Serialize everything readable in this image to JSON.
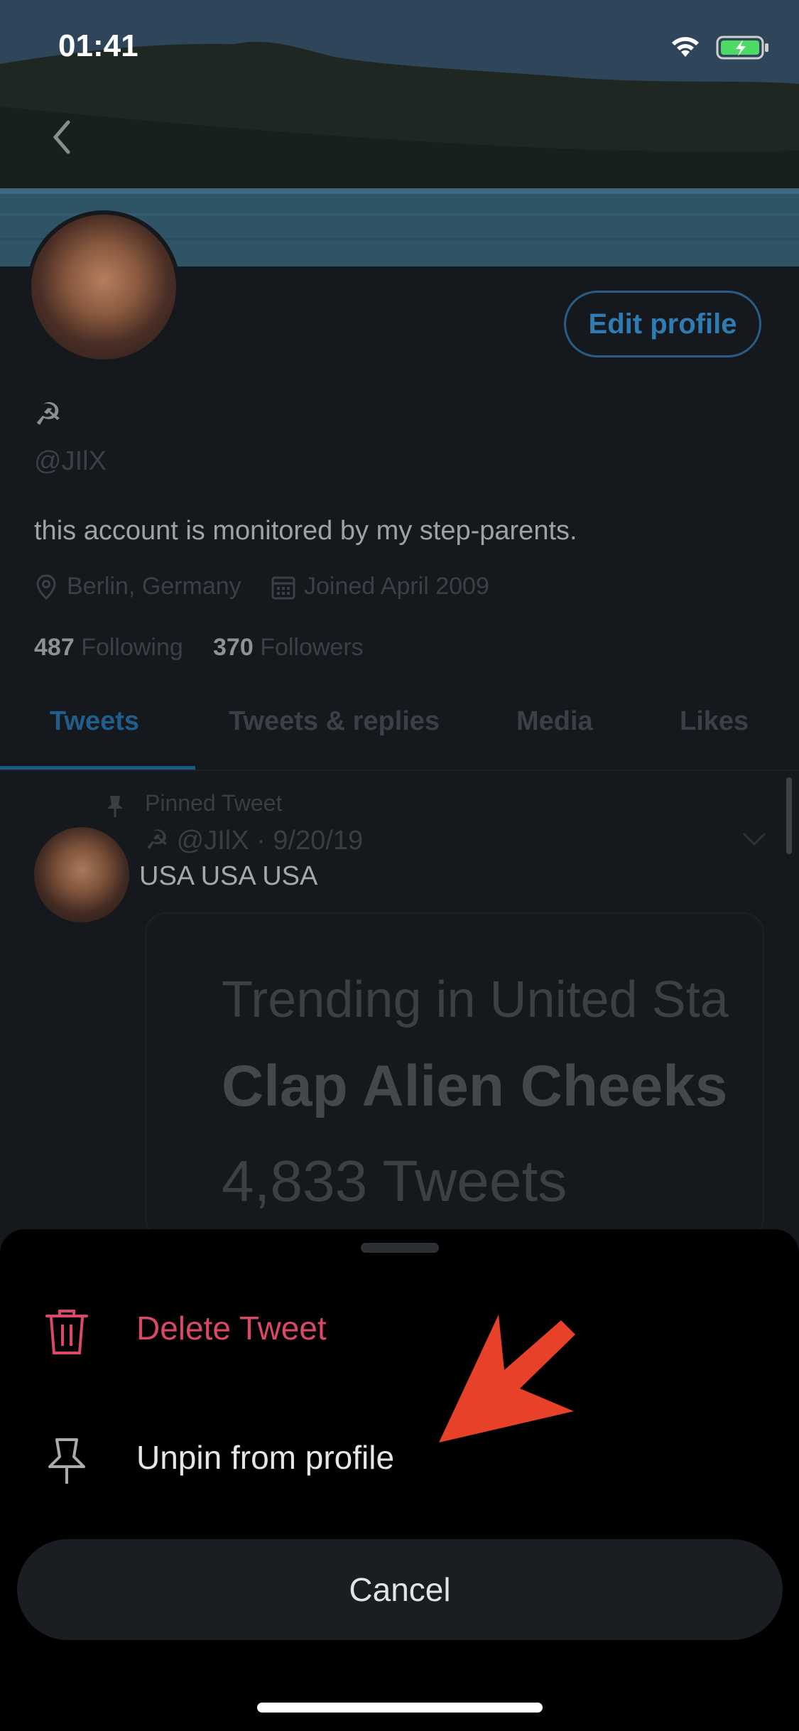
{
  "status_bar": {
    "time": "01:41"
  },
  "profile": {
    "edit_button": "Edit profile",
    "name": "☭",
    "handle": "@JIlX",
    "bio": "this account is monitored by my step-parents.",
    "location": "Berlin, Germany",
    "joined": "Joined April 2009",
    "following_count": "487",
    "following_label": "Following",
    "followers_count": "370",
    "followers_label": "Followers"
  },
  "tabs": [
    {
      "label": "Tweets",
      "active": true
    },
    {
      "label": "Tweets & replies",
      "active": false
    },
    {
      "label": "Media",
      "active": false
    },
    {
      "label": "Likes",
      "active": false
    }
  ],
  "pinned_tweet": {
    "pinned_label": "Pinned Tweet",
    "meta": "☭ @JIlX · 9/20/19",
    "text": "USA USA USA",
    "card": {
      "line1": "Trending in United Sta",
      "line2": "Clap Alien Cheeks",
      "line3": "4,833 Tweets"
    }
  },
  "action_sheet": {
    "delete_label": "Delete Tweet",
    "unpin_label": "Unpin from profile",
    "cancel_label": "Cancel"
  },
  "colors": {
    "background": "#15181c",
    "accent": "#1d9bf0",
    "destructive": "#d94864",
    "annotation_arrow": "#e8412a"
  }
}
